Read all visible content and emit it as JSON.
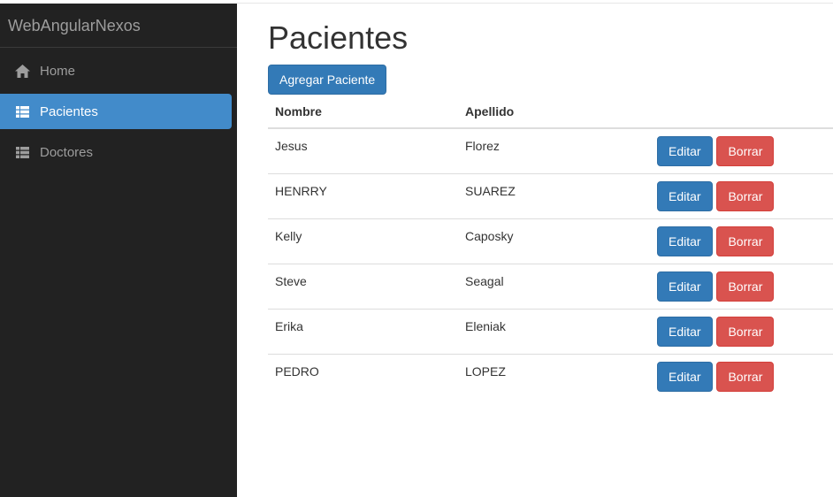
{
  "sidebar": {
    "brand": "WebAngularNexos",
    "items": [
      {
        "label": "Home",
        "icon": "home-icon",
        "active": false
      },
      {
        "label": "Pacientes",
        "icon": "list-icon",
        "active": true
      },
      {
        "label": "Doctores",
        "icon": "list-icon",
        "active": false
      }
    ]
  },
  "main": {
    "title": "Pacientes",
    "add_button": "Agregar Paciente",
    "table": {
      "headers": [
        "Nombre",
        "Apellido",
        ""
      ],
      "edit_label": "Editar",
      "delete_label": "Borrar",
      "rows": [
        {
          "nombre": "Jesus",
          "apellido": "Florez"
        },
        {
          "nombre": "HENRRY",
          "apellido": "SUAREZ"
        },
        {
          "nombre": "Kelly",
          "apellido": "Caposky"
        },
        {
          "nombre": "Steve",
          "apellido": "Seagal"
        },
        {
          "nombre": "Erika",
          "apellido": "Eleniak"
        },
        {
          "nombre": "PEDRO",
          "apellido": "LOPEZ"
        }
      ]
    }
  },
  "colors": {
    "sidebar_bg": "#222222",
    "active_bg": "#428bca",
    "primary": "#337ab7",
    "danger": "#d9534f"
  }
}
